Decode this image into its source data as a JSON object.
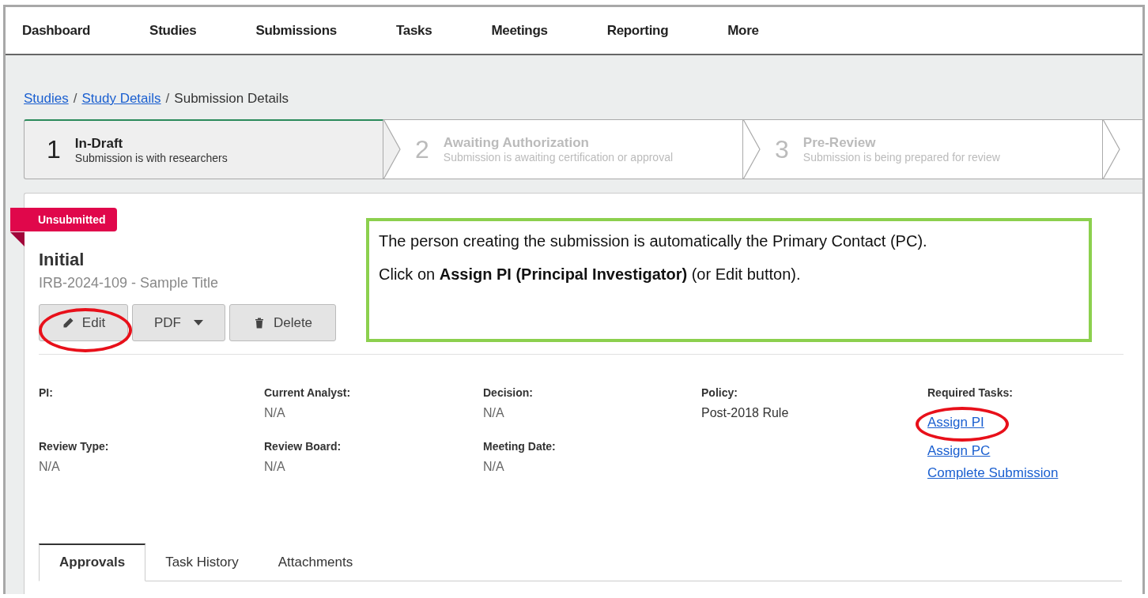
{
  "nav": {
    "items": [
      {
        "label": "Dashboard"
      },
      {
        "label": "Studies"
      },
      {
        "label": "Submissions"
      },
      {
        "label": "Tasks"
      },
      {
        "label": "Meetings"
      },
      {
        "label": "Reporting"
      },
      {
        "label": "More"
      }
    ]
  },
  "breadcrumbs": {
    "separator": "/",
    "items": [
      {
        "label": "Studies",
        "kind": "link"
      },
      {
        "label": "Study Details",
        "kind": "link"
      },
      {
        "label": "Submission Details",
        "kind": "current"
      }
    ]
  },
  "steps": [
    {
      "number": "1",
      "title": "In-Draft",
      "subtitle": "Submission is with researchers",
      "selected": true
    },
    {
      "number": "2",
      "title": "Awaiting Authorization",
      "subtitle": "Submission is awaiting certification or approval",
      "selected": false
    },
    {
      "number": "3",
      "title": "Pre-Review",
      "subtitle": "Submission is being prepared for review",
      "selected": false
    }
  ],
  "submission": {
    "status_badge": "Unsubmitted",
    "title": "Initial",
    "subtitle": "IRB-2024-109 - Sample Title",
    "buttons": [
      {
        "label": "Edit",
        "kind": "edit"
      },
      {
        "label": "PDF",
        "kind": "pdf"
      },
      {
        "label": "Delete",
        "kind": "delete"
      }
    ]
  },
  "callout": {
    "paragraphs": [
      "The person creating the submission is automatically the Primary Contact (PC).",
      "Click on **Assign PI (Principal Investigator)** (or Edit button)."
    ]
  },
  "fields": [
    {
      "label": "PI:"
    },
    {
      "label": "Current Analyst:",
      "value": "N/A"
    },
    {
      "label": "Decision:",
      "value": "N/A"
    },
    {
      "label": "Policy:",
      "value": "Post-2018 Rule"
    },
    {
      "label": "Review Type:",
      "value": "N/A"
    },
    {
      "label": "Review Board:",
      "value": "N/A"
    },
    {
      "label": "Meeting Date:",
      "value": "N/A"
    }
  ],
  "required_tasks": {
    "label": "Required Tasks:",
    "links": [
      "Assign PI",
      "Assign PC",
      "Complete Submission"
    ]
  },
  "tabs": [
    {
      "label": "Approvals",
      "selected": true
    },
    {
      "label": "Task History",
      "selected": false
    },
    {
      "label": "Attachments",
      "selected": false
    }
  ]
}
